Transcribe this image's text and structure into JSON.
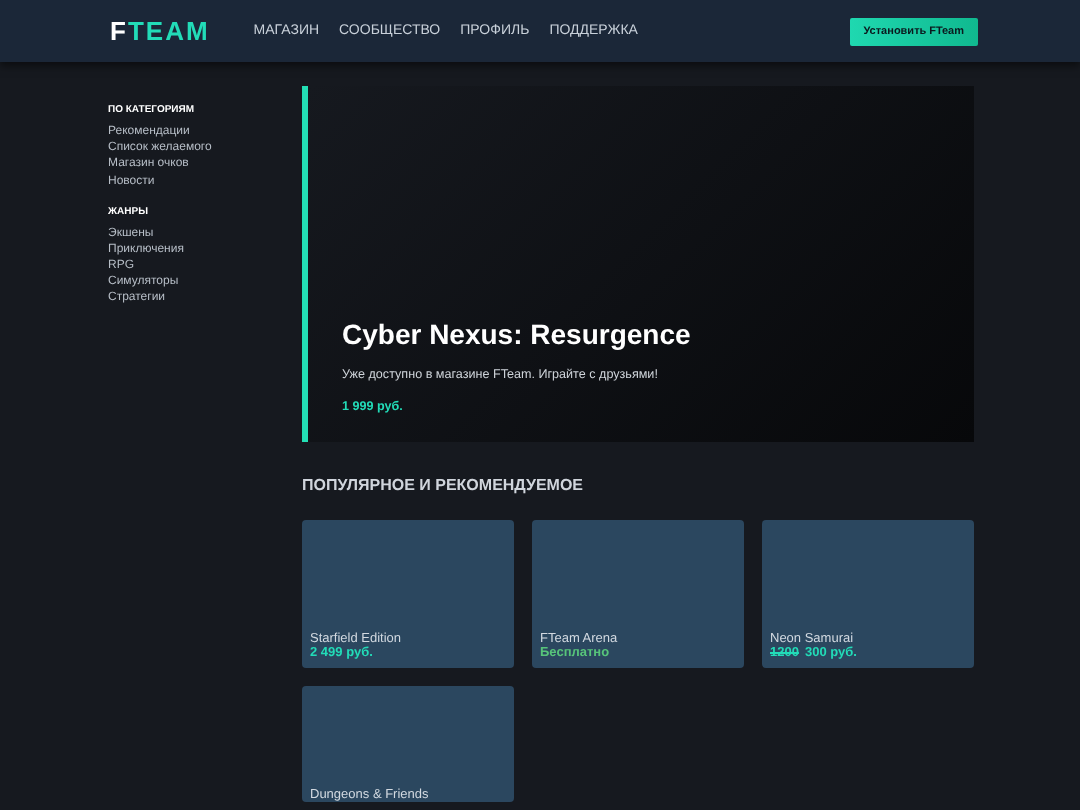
{
  "header": {
    "logo": {
      "first": "F",
      "second": "TEAM"
    },
    "nav": [
      "МАГАЗИН",
      "СООБЩЕСТВО",
      "ПРОФИЛЬ",
      "ПОДДЕРЖКА"
    ],
    "install_button": "Установить FTeam"
  },
  "sidebar": [
    {
      "heading": "ПО КАТЕГОРИЯМ",
      "items": [
        "Рекомендации",
        "Список желаемого",
        "Магазин очков",
        "Новости"
      ]
    },
    {
      "heading": "ЖАНРЫ",
      "items": [
        "Экшены",
        "Приключения",
        "RPG",
        "Симуляторы",
        "Стратегии"
      ]
    }
  ],
  "hero": {
    "title": "Cyber Nexus: Resurgence",
    "text": "Уже доступно в магазине FTeam. Играйте с друзьями!",
    "price": "1 999 руб."
  },
  "section_title": "ПОПУЛЯРНОЕ И РЕКОМЕНДУЕМОЕ",
  "games": [
    {
      "name": "Starfield Edition",
      "kind": "paid",
      "price": "2 499 руб."
    },
    {
      "name": "FTeam Arena",
      "kind": "free",
      "price": "Бесплатно"
    },
    {
      "name": "Neon Samurai",
      "kind": "discount",
      "old_price": "1200",
      "price": "300 руб."
    },
    {
      "name": "Dungeons & Friends",
      "kind": "none"
    }
  ]
}
